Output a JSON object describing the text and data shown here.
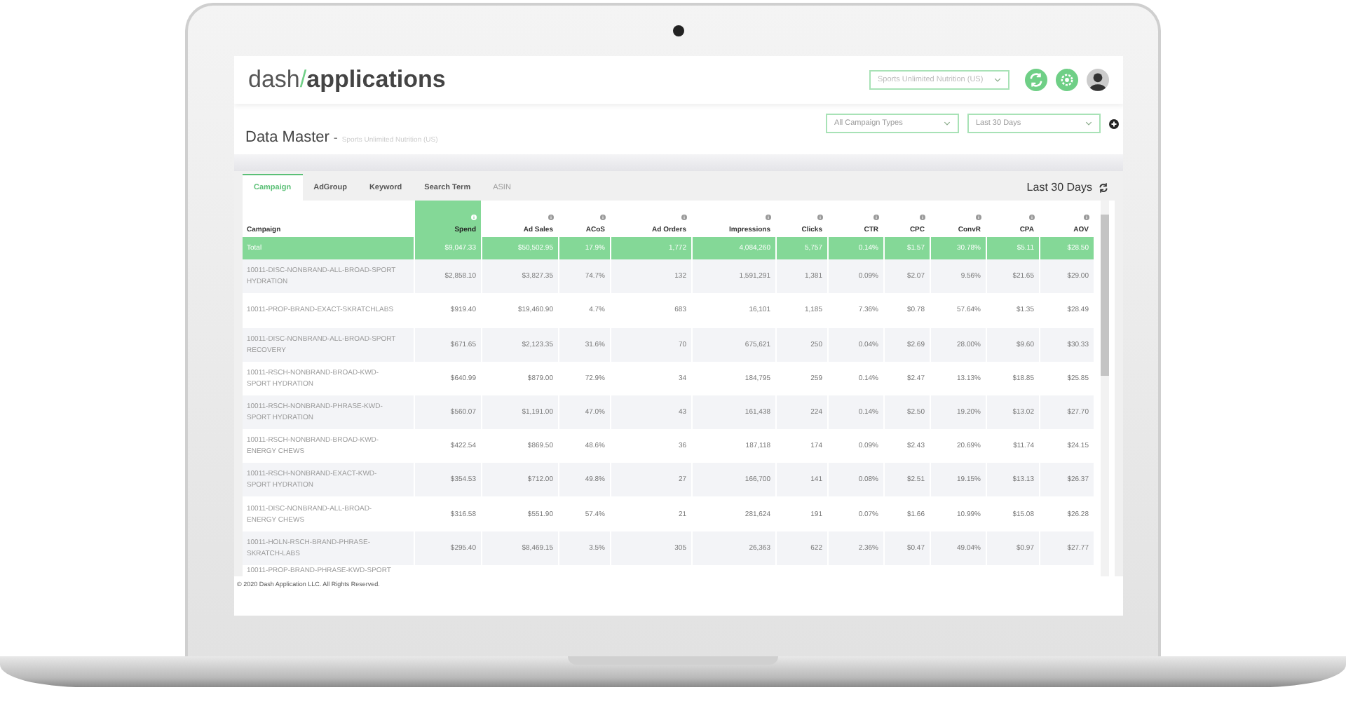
{
  "header": {
    "logo": {
      "light": "dash",
      "slash": "/",
      "bold": "applications"
    },
    "account_select": "Sports Unlimited Nutrition (US)"
  },
  "page": {
    "title": "Data Master",
    "separator": "-",
    "subtitle": "Sports Unlimited Nutrition (US)",
    "filters": [
      "All Campaign Types",
      "Last 30 Days"
    ]
  },
  "tabs": [
    {
      "label": "Campaign",
      "selected": true,
      "disabled": false
    },
    {
      "label": "AdGroup",
      "selected": false,
      "disabled": false
    },
    {
      "label": "Keyword",
      "selected": false,
      "disabled": false
    },
    {
      "label": "Search Term",
      "selected": false,
      "disabled": false
    },
    {
      "label": "ASIN",
      "selected": false,
      "disabled": true
    }
  ],
  "range_label": "Last 30 Days",
  "table": {
    "columns": [
      {
        "label": "Campaign",
        "info": false,
        "sorted": false
      },
      {
        "label": "Spend",
        "info": true,
        "sorted": true
      },
      {
        "label": "Ad Sales",
        "info": true,
        "sorted": false
      },
      {
        "label": "ACoS",
        "info": true,
        "sorted": false
      },
      {
        "label": "Ad Orders",
        "info": true,
        "sorted": false
      },
      {
        "label": "Impressions",
        "info": true,
        "sorted": false
      },
      {
        "label": "Clicks",
        "info": true,
        "sorted": false
      },
      {
        "label": "CTR",
        "info": true,
        "sorted": false
      },
      {
        "label": "CPC",
        "info": true,
        "sorted": false
      },
      {
        "label": "ConvR",
        "info": true,
        "sorted": false
      },
      {
        "label": "CPA",
        "info": true,
        "sorted": false
      },
      {
        "label": "AOV",
        "info": true,
        "sorted": false
      }
    ],
    "total": [
      "Total",
      "$9,047.33",
      "$50,502.95",
      "17.9%",
      "1,772",
      "4,084,260",
      "5,757",
      "0.14%",
      "$1.57",
      "30.78%",
      "$5.11",
      "$28.50"
    ],
    "rows": [
      [
        "10011-DISC-NONBRAND-ALL-BROAD-SPORT HYDRATION",
        "$2,858.10",
        "$3,827.35",
        "74.7%",
        "132",
        "1,591,291",
        "1,381",
        "0.09%",
        "$2.07",
        "9.56%",
        "$21.65",
        "$29.00"
      ],
      [
        "10011-PROP-BRAND-EXACT-SKRATCHLABS",
        "$919.40",
        "$19,460.90",
        "4.7%",
        "683",
        "16,101",
        "1,185",
        "7.36%",
        "$0.78",
        "57.64%",
        "$1.35",
        "$28.49"
      ],
      [
        "10011-DISC-NONBRAND-ALL-BROAD-SPORT RECOVERY",
        "$671.65",
        "$2,123.35",
        "31.6%",
        "70",
        "675,621",
        "250",
        "0.04%",
        "$2.69",
        "28.00%",
        "$9.60",
        "$30.33"
      ],
      [
        "10011-RSCH-NONBRAND-BROAD-KWD-SPORT HYDRATION",
        "$640.99",
        "$879.00",
        "72.9%",
        "34",
        "184,795",
        "259",
        "0.14%",
        "$2.47",
        "13.13%",
        "$18.85",
        "$25.85"
      ],
      [
        "10011-RSCH-NONBRAND-PHRASE-KWD-SPORT HYDRATION",
        "$560.07",
        "$1,191.00",
        "47.0%",
        "43",
        "161,438",
        "224",
        "0.14%",
        "$2.50",
        "19.20%",
        "$13.02",
        "$27.70"
      ],
      [
        "10011-RSCH-NONBRAND-BROAD-KWD-ENERGY CHEWS",
        "$422.54",
        "$869.50",
        "48.6%",
        "36",
        "187,118",
        "174",
        "0.09%",
        "$2.43",
        "20.69%",
        "$11.74",
        "$24.15"
      ],
      [
        "10011-RSCH-NONBRAND-EXACT-KWD-SPORT HYDRATION",
        "$354.53",
        "$712.00",
        "49.8%",
        "27",
        "166,700",
        "141",
        "0.08%",
        "$2.51",
        "19.15%",
        "$13.13",
        "$26.37"
      ],
      [
        "10011-DISC-NONBRAND-ALL-BROAD-ENERGY CHEWS",
        "$316.58",
        "$551.90",
        "57.4%",
        "21",
        "281,624",
        "191",
        "0.07%",
        "$1.66",
        "10.99%",
        "$15.08",
        "$26.28"
      ],
      [
        "10011-HOLN-RSCH-BRAND-PHRASE-SKRATCH-LABS",
        "$295.40",
        "$8,469.15",
        "3.5%",
        "305",
        "26,363",
        "622",
        "2.36%",
        "$0.47",
        "49.04%",
        "$0.97",
        "$27.77"
      ],
      [
        "10011-PROP-BRAND-PHRASE-KWD-SPORT"
      ]
    ]
  },
  "footer": "© 2020 Dash Application LLC. All Rights Reserved."
}
